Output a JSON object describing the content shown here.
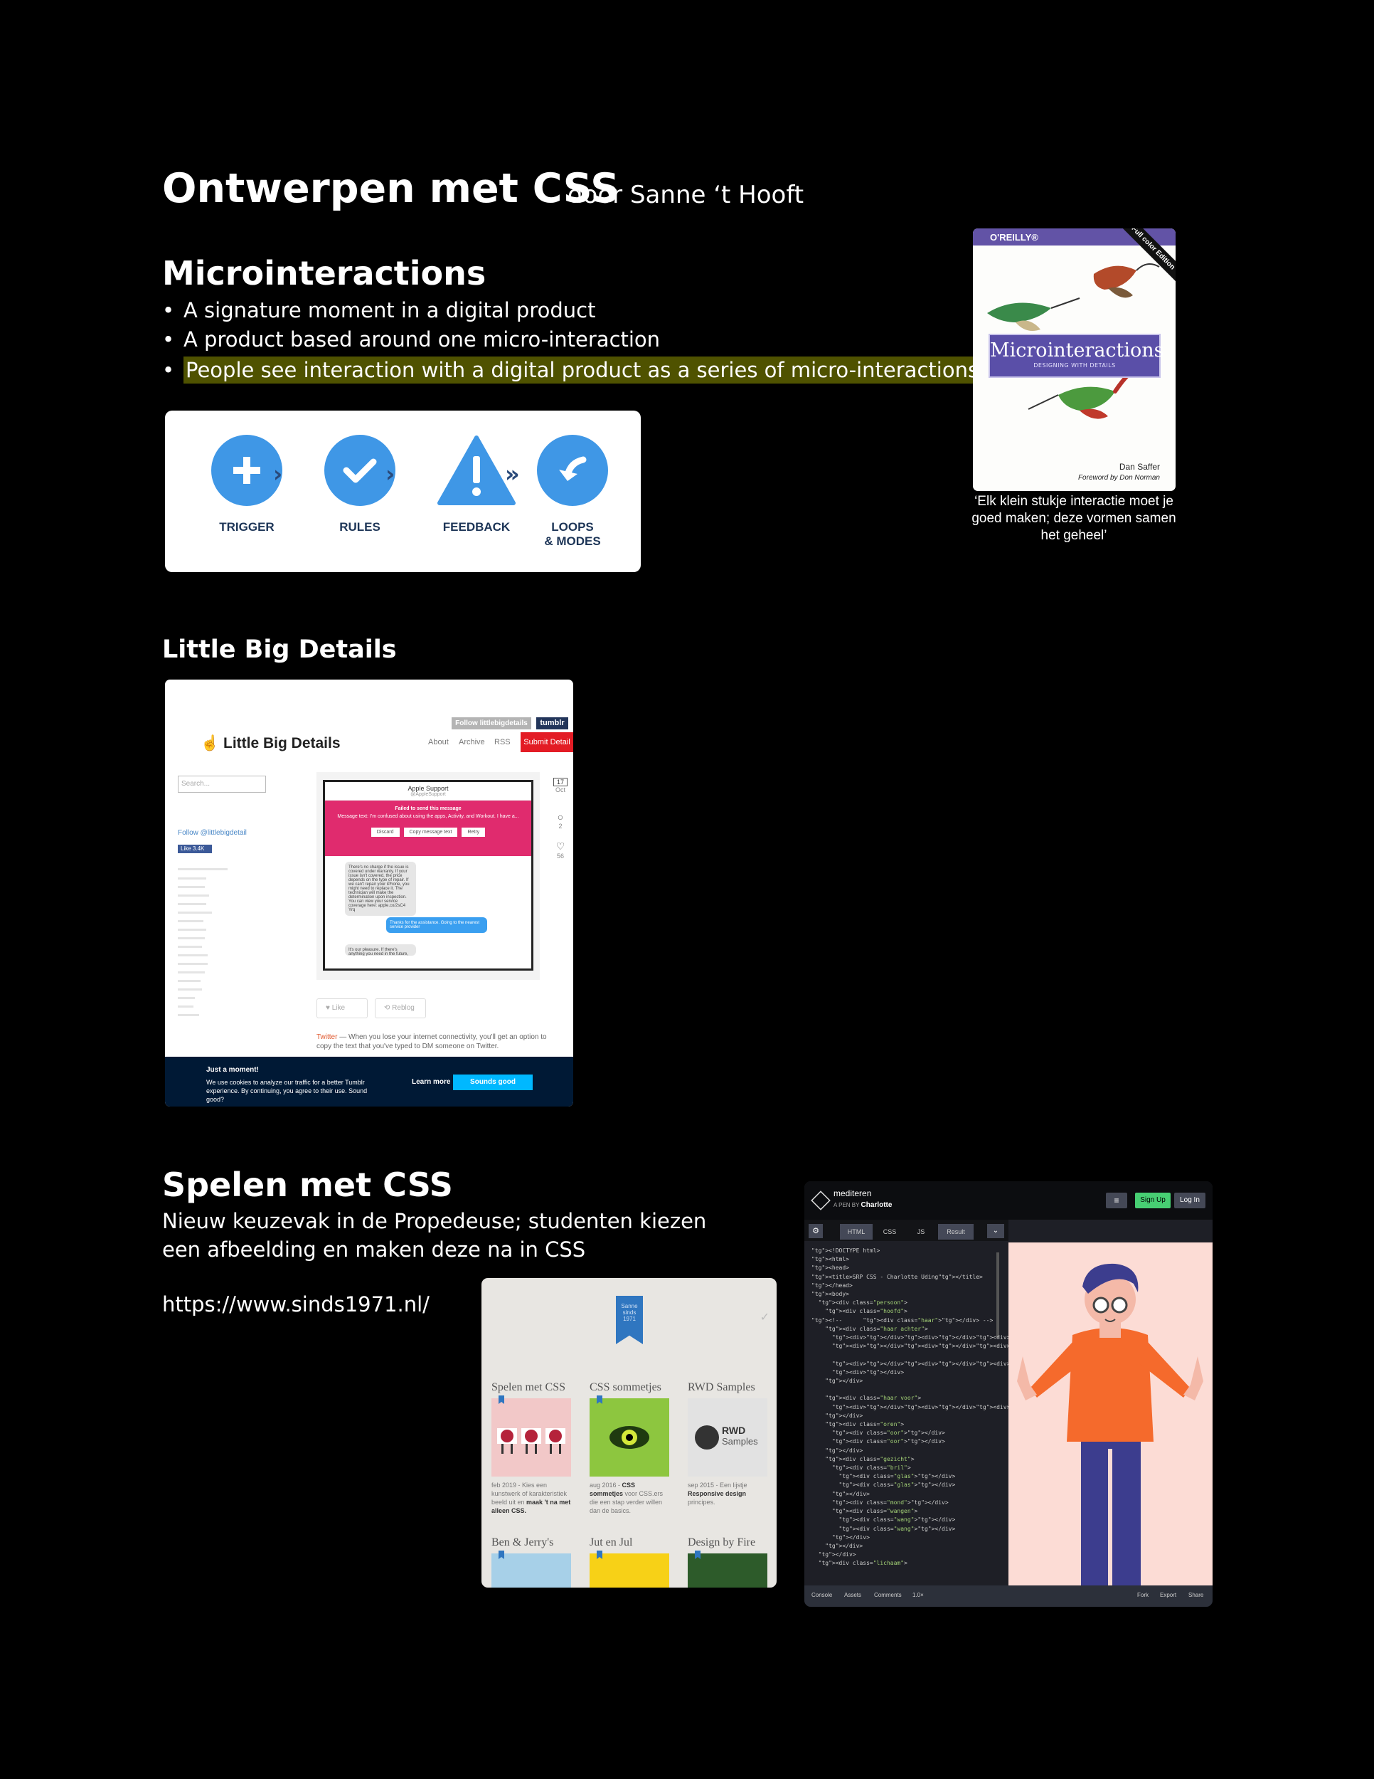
{
  "header": {
    "title": "Ontwerpen met CSS",
    "byline": "door Sanne ‘t Hooft"
  },
  "micro": {
    "heading": "Microinteractions",
    "bullets": [
      "A signature moment in a digital product",
      "A product based around one micro-interaction",
      "People see interaction with a digital product as a series of micro-interactions"
    ],
    "highlight_color": "#4f5200",
    "steps": [
      {
        "label": "TRIGGER",
        "icon": "plus-icon"
      },
      {
        "label": "RULES",
        "icon": "check-icon"
      },
      {
        "label": "FEEDBACK",
        "icon": "warning-icon"
      },
      {
        "label": "LOOPS\n& MODES",
        "icon": "loop-arrow-icon"
      }
    ],
    "accent": "#3f97e6"
  },
  "book": {
    "publisher": "O'REILLY®",
    "corner": "Full color Edition",
    "title": "Microinteractions",
    "subtitle": "DESIGNING WITH DETAILS",
    "author": "Dan Saffer",
    "foreword": "Foreword by Don Norman",
    "quote": "‘Elk klein stukje interactie moet je goed maken; deze vormen samen het geheel’"
  },
  "lbd": {
    "heading": "Little Big Details",
    "follow_btn": "Follow littlebigdetails",
    "tumblr_btn": "tumblr",
    "logo": "Little Big Details",
    "nav": [
      "About",
      "Archive",
      "RSS"
    ],
    "submit": "Submit Detail",
    "search_placeholder": "Search...",
    "follow_link": "Follow @littlebigdetail",
    "fb_like": "Like 3.4K",
    "phone": {
      "contact": "Apple Support",
      "handle": "@AppleSupport",
      "error": "Failed to send this message",
      "error_detail": "Message text: I'm confused about using the apps, Activity, and Workout. I have a...",
      "buttons": [
        "Discard",
        "Copy message text",
        "Retry"
      ],
      "reply": "There's no charge if the issue is covered under warranty. If your issue isn't covered, the price depends on the type of repair. If we can't repair your iPhone, you might need to replace it. The technician will make the determination upon inspection. You can view your service coverage here: apple.co/2sC4 Yrq",
      "sent": "Thanks for the assistance. Going to the nearest service provider",
      "last": "It's our pleasure. If there's anything you need in the future, please just let us know. We're here"
    },
    "date_day": "17",
    "date_month": "Oct",
    "comments": "2",
    "likes": "56",
    "like_btn": "Like",
    "reblog_btn": "Reblog",
    "caption_source": "Twitter",
    "caption": " — When you lose your internet connectivity, you'll get an option to copy the text that you've typed to DM someone on Twitter.",
    "cookie_title": "Just a moment!",
    "cookie_text": "We use cookies to analyze our traffic for a better Tumblr experience. By continuing, you agree to their use. Sound good?",
    "learn_more": "Learn more",
    "sounds_good": "Sounds good"
  },
  "spelen": {
    "heading": "Spelen met CSS",
    "desc": "Nieuw keuzevak in de Propedeuse; studenten kiezen een afbeelding en maken deze na in CSS",
    "url": "https://www.sinds1971.nl/"
  },
  "sinds": {
    "ribbon": "Sanne sinds 1971",
    "tiles": [
      {
        "title": "Spelen met CSS",
        "date": "feb 2019 - ",
        "desc_a": "Kies een kunstwerk of karakteristiek beeld uit en ",
        "desc_b": "maak 't na met alleen CSS.",
        "color": "#f2c8c8"
      },
      {
        "title": "CSS sommetjes",
        "date": "aug 2016 - ",
        "desc_a": "",
        "desc_b": "CSS sommetjes",
        "desc_c": " voor CSS.ers die een stap verder willen dan de basics.",
        "color": "#8dc63f"
      },
      {
        "title": "RWD Samples",
        "date": "sep 2015 - ",
        "desc_a": "Een lijstje ",
        "desc_b": "Responsive design",
        "desc_c": " principes.",
        "color": "#e2e2e2"
      },
      {
        "title": "Ben & Jerry's",
        "color": "#a7d0e8"
      },
      {
        "title": "Jut en Jul",
        "color": "#f7d117"
      },
      {
        "title": "Design by Fire",
        "color": "#2d5b2a"
      }
    ],
    "rwd_label_a": "RWD",
    "rwd_label_b": "Samples"
  },
  "codepen": {
    "title": "mediteren",
    "by_prefix": "A PEN BY ",
    "author": "Charlotte",
    "signup": "Sign Up",
    "login": "Log In",
    "tabs": [
      "HTML",
      "CSS",
      "JS",
      "Result"
    ],
    "footer": [
      "Console",
      "Assets",
      "Comments",
      "1.0×",
      "Fork",
      "Export",
      "Share"
    ],
    "code_lines": [
      "<!DOCTYPE html>",
      "<html>",
      "<head>",
      "<title>SRP CSS - Charlotte Uding</title>",
      "</head>",
      "<body>",
      "  <div class=\"persoon\">",
      "    <div class=\"hoofd\">",
      "<!--      <div class=\"haar\"></div> -->",
      "    <div class=\"haar achter\">",
      "      <div></div><div></div><div></div>",
      "      <div></div><div></div><div></div>",
      "",
      "      <div></div><div></div><div></div>",
      "      <div></div>",
      "    </div>",
      "",
      "    <div class=\"haar voor\">",
      "      <div></div><div></div><div></div>",
      "    </div>",
      "    <div class=\"oren\">",
      "      <div class=\"oor\"></div>",
      "      <div class=\"oor\"></div>",
      "    </div>",
      "    <div class=\"gezicht\">",
      "      <div class=\"bril\">",
      "        <div class=\"glas\"></div>",
      "        <div class=\"glas\"></div>",
      "      </div>",
      "      <div class=\"mond\"></div>",
      "      <div class=\"wangen\">",
      "        <div class=\"wang\"></div>",
      "        <div class=\"wang\"></div>",
      "      </div>",
      "    </div>",
      "  </div>",
      "  <div class=\"lichaam\">"
    ]
  }
}
